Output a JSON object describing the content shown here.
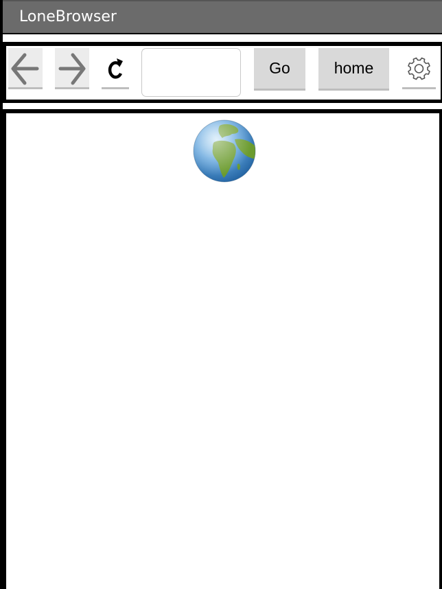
{
  "app": {
    "title": "LoneBrowser"
  },
  "toolbar": {
    "back_icon": "arrow-left-icon",
    "forward_icon": "arrow-right-icon",
    "reload_icon": "reload-icon",
    "url": {
      "value": "",
      "placeholder": ""
    },
    "go_label": "Go",
    "home_label": "home",
    "settings_icon": "gear-icon"
  },
  "content": {
    "icon": "globe-icon"
  },
  "colors": {
    "titlebar": "#6b6b6b",
    "title_text": "#ffffff",
    "frame": "#000000",
    "button_bg": "#d9d9d9",
    "icon_button_bg": "#ececec",
    "icon_gray": "#777777"
  }
}
